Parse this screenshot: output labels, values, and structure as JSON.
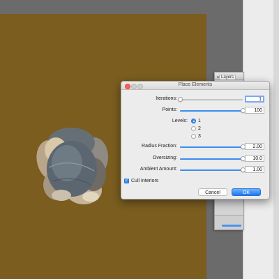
{
  "dialog": {
    "title": "Place Elements",
    "iterations": {
      "label": "Iterations:",
      "value": "1",
      "fraction": 0.0
    },
    "points": {
      "label": "Points:",
      "value": "100",
      "fraction": 1.0
    },
    "levels": {
      "label": "Levels:",
      "options": [
        "1",
        "2",
        "3"
      ],
      "selected": "1"
    },
    "radius_fraction": {
      "label": "Radius Fraction:",
      "value": "2.00",
      "fraction": 1.0
    },
    "oversizing": {
      "label": "Oversizing:",
      "value": "10.0",
      "fraction": 1.0
    },
    "ambient_amount": {
      "label": "Ambient Amount:",
      "value": "1.00",
      "fraction": 1.0
    },
    "cull_interiors": {
      "label": "Cull Interiors",
      "checked": true
    },
    "cancel_label": "Cancel",
    "ok_label": "OK"
  },
  "layers_panel": {
    "tab_label": "Layers"
  },
  "colors": {
    "accent": "#3b8cf0",
    "document_bg": "#7a5d1f",
    "workspace_bg": "#6b6b6b"
  }
}
